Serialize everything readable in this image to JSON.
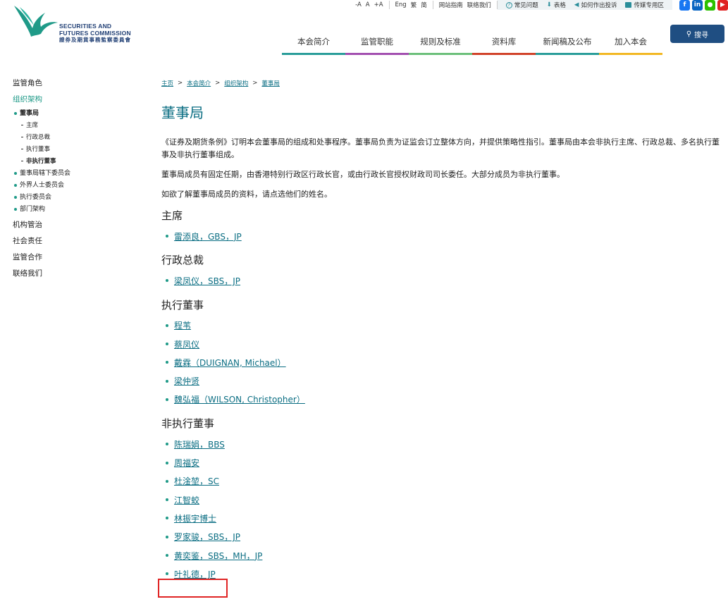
{
  "logo": {
    "line1": "SECURITIES AND",
    "line2": "FUTURES COMMISSION",
    "line3": "證券及期貨事務監察委員會"
  },
  "utility": {
    "font_sizes": [
      "-A",
      "A",
      "+A"
    ],
    "languages": [
      "Eng",
      "繁",
      "简"
    ],
    "links": [
      "网站指南",
      "联络我们"
    ],
    "quick": [
      "常见问题",
      "表格",
      "如何作出投诉",
      "传媒专用区"
    ]
  },
  "social": [
    {
      "name": "facebook-icon",
      "glyph": "f",
      "color": "#1877f2"
    },
    {
      "name": "linkedin-icon",
      "glyph": "in",
      "color": "#0a66c2"
    },
    {
      "name": "wechat-icon",
      "glyph": "●",
      "color": "#2dc100"
    },
    {
      "name": "youtube-icon",
      "glyph": "▶",
      "color": "#e02424"
    }
  ],
  "nav": [
    {
      "label": "本会简介",
      "color": "#2a9d9a"
    },
    {
      "label": "监管职能",
      "color": "#a34fb0"
    },
    {
      "label": "规则及标准",
      "color": "#6cc07a"
    },
    {
      "label": "资料库",
      "color": "#d1432a"
    },
    {
      "label": "新闻稿及公布",
      "color": "#2a9d9a"
    },
    {
      "label": "加入本会",
      "color": "#f2b824"
    }
  ],
  "search_label": "搜寻",
  "sidebar": {
    "item1": "监管角色",
    "active": "组织架构",
    "sub_current": "董事局",
    "sub2": [
      "主席",
      "行政总裁",
      "执行董事",
      "非执行董事"
    ],
    "sub_others": [
      "董事局辖下委员会",
      "外界人士委员会",
      "执行委员会",
      "部门架构"
    ],
    "bottom": [
      "机构管治",
      "社会责任",
      "监管合作",
      "联络我们"
    ]
  },
  "breadcrumb": [
    "主页",
    "本会简介",
    "组织架构",
    "董事局"
  ],
  "page_title": "董事局",
  "paragraphs": [
    "《证券及期货条例》订明本会董事局的组成和处事程序。董事局负责为证监会订立整体方向，并提供策略性指引。董事局由本会非执行主席、行政总裁、多名执行董事及非执行董事组成。",
    "董事局成员有固定任期，由香港特别行政区行政长官，或由行政长官授权财政司司长委任。大部分成员为非执行董事。",
    "如欲了解董事局成员的资料，请点选他们的姓名。"
  ],
  "sections": [
    {
      "heading": "主席",
      "members": [
        "雷添良，GBS，JP"
      ]
    },
    {
      "heading": "行政总裁",
      "members": [
        "梁凤仪，SBS，JP"
      ]
    },
    {
      "heading": "执行董事",
      "members": [
        "程苇",
        "蔡凤仪",
        "戴霖（DUIGNAN, Michael）",
        "梁仲贤",
        "魏弘福（WILSON, Christopher）"
      ]
    },
    {
      "heading": "非执行董事",
      "members": [
        "陈瑞娟，BBS",
        "周福安",
        "杜淦堃，SC",
        "江智蛟",
        "林振宇博士",
        "罗家骏，SBS，JP",
        "黄奕鉴，SBS，MH，JP",
        "叶礼德，JP"
      ]
    }
  ]
}
